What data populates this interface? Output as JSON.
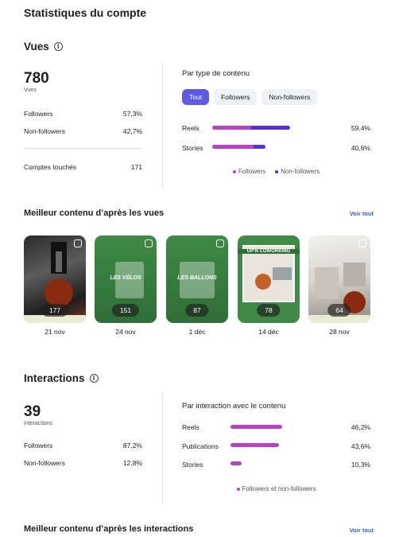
{
  "page_title": "Statistiques du compte",
  "views": {
    "title": "Vues",
    "total": "780",
    "total_label": "Vues",
    "followers_label": "Followers",
    "followers_value": "57,3%",
    "nonfollowers_label": "Non-followers",
    "nonfollowers_value": "42,7%",
    "reach_label": "Comptes touchés",
    "reach_value": "171",
    "by_type_title": "Par type de contenu",
    "filters": [
      "Tout",
      "Followers",
      "Non-followers"
    ],
    "active_filter": "Tout",
    "rows": [
      {
        "label": "Reels",
        "value": "59,4%",
        "followers_frac": 0.51,
        "total_frac": 1.0
      },
      {
        "label": "Stories",
        "value": "40,6%",
        "followers_frac": 0.55,
        "total_frac": 0.68
      }
    ],
    "legend": [
      "Followers",
      "Non-followers"
    ]
  },
  "best_views": {
    "title": "Meilleur contenu d’après les vues",
    "see_all": "Voir tout",
    "items": [
      {
        "count": "177",
        "date": "21 nov",
        "label": ""
      },
      {
        "count": "151",
        "date": "24 nov",
        "label": "LES VÉLOS"
      },
      {
        "count": "87",
        "date": "1 déc",
        "label": "LES BALLONS"
      },
      {
        "count": "78",
        "date": "14 déc",
        "label": "UP'N COWORKING"
      },
      {
        "count": "64",
        "date": "28 nov",
        "label": ""
      }
    ]
  },
  "interactions": {
    "title": "Interactions",
    "total": "39",
    "total_label": "Interactions",
    "followers_label": "Followers",
    "followers_value": "87,2%",
    "nonfollowers_label": "Non-followers",
    "nonfollowers_value": "12,8%",
    "by_interaction_title": "Par interaction avec le contenu",
    "rows": [
      {
        "label": "Reels",
        "value": "46,2%",
        "frac": 1.0
      },
      {
        "label": "Publications",
        "value": "43,6%",
        "frac": 0.94
      },
      {
        "label": "Stories",
        "value": "10,3%",
        "frac": 0.22
      }
    ],
    "legend": "Followers et non-followers"
  },
  "best_interactions": {
    "title": "Meilleur contenu d’après les interactions",
    "see_all": "Voir tout"
  },
  "colors": {
    "followers": "#b743c2",
    "non_followers": "#5530d8",
    "accent": "#5b5ce2",
    "link": "#3b5bdb"
  }
}
